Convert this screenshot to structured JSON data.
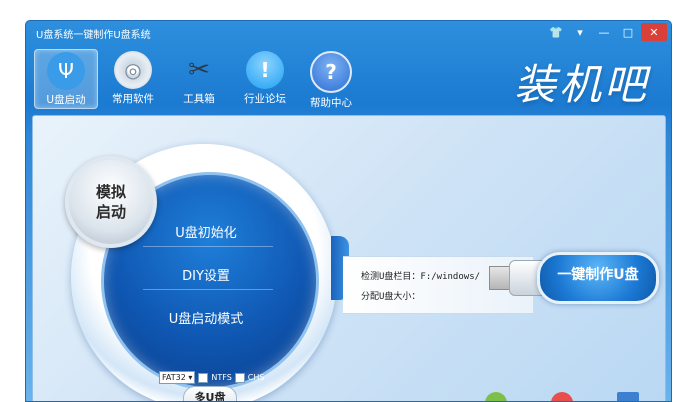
{
  "window": {
    "title": "U盘系统一键制作U盘系统"
  },
  "window_controls": [
    {
      "name": "skin-icon",
      "glyph": "👕"
    },
    {
      "name": "menu-icon",
      "glyph": "▾"
    },
    {
      "name": "minimize-icon",
      "glyph": "—"
    },
    {
      "name": "maximize-icon",
      "glyph": "□"
    },
    {
      "name": "close-icon",
      "glyph": "✕"
    }
  ],
  "toolbar": {
    "items": [
      {
        "label": "U盘启动",
        "icon": "usb-icon",
        "glyph": "Ψ",
        "active": true,
        "color": "#3a9be8"
      },
      {
        "label": "常用软件",
        "icon": "disc-icon",
        "glyph": "◎",
        "active": false,
        "color": "#c9d6e3"
      },
      {
        "label": "工具箱",
        "icon": "tools-icon",
        "glyph": "✂",
        "active": false,
        "color": "#6c7a88"
      },
      {
        "label": "行业论坛",
        "icon": "forum-icon",
        "glyph": "!",
        "active": false,
        "color": "#1da1f2"
      },
      {
        "label": "帮助中心",
        "icon": "help-icon",
        "glyph": "?",
        "active": false,
        "color": "#2b6fd6"
      }
    ]
  },
  "brand": {
    "text": "装机吧"
  },
  "main": {
    "simulate_button": {
      "line1": "模拟",
      "line2": "启动"
    },
    "menu": [
      {
        "label": "U盘初始化"
      },
      {
        "label": "DIY设置"
      },
      {
        "label": "U盘启动模式"
      }
    ],
    "filesystem": {
      "selected": "FAT32",
      "option_ntfs": "NTFS",
      "option_chs": "CHS"
    },
    "multi_u_label": "多U盘",
    "info": {
      "detect_label": "检测U盘栏目：",
      "detect_value": "F:/windows/",
      "capacity_label": "分配U盘大小："
    },
    "make_button": "一键制作U盘"
  }
}
